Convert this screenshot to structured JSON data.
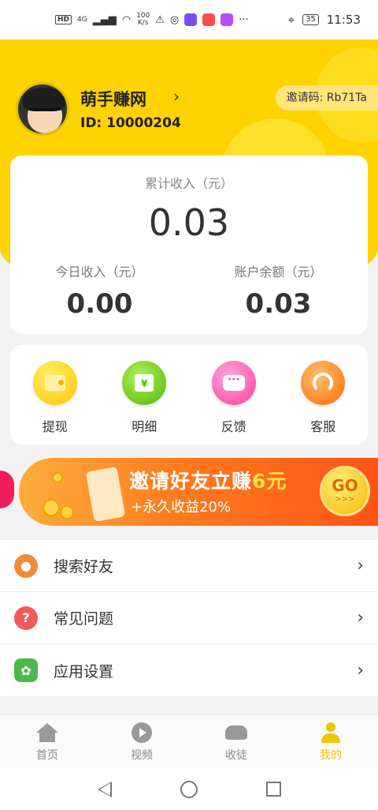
{
  "status_bar": {
    "hd": "HD",
    "network": "4G",
    "speed_value": "100",
    "speed_unit": "K/s",
    "battery": "35",
    "time": "11:53",
    "more": "···"
  },
  "profile": {
    "name": "萌手赚网",
    "id_label": "ID: 10000204",
    "invite_code_label": "邀请码: Rb71Ta",
    "arrow": "›"
  },
  "stats": {
    "total_label": "累计收入（元）",
    "total_value": "0.03",
    "today_label": "今日收入（元）",
    "today_value": "0.00",
    "balance_label": "账户余额（元）",
    "balance_value": "0.03"
  },
  "actions": [
    {
      "label": "提现",
      "color": "#ffd21a"
    },
    {
      "label": "明细",
      "color": "#6ad321"
    },
    {
      "label": "反馈",
      "color": "#ff5fb5"
    },
    {
      "label": "客服",
      "color": "#ff8f1c"
    }
  ],
  "banner": {
    "title_main": "邀请好友立赚",
    "title_amount": "6元",
    "subtitle": "+永久收益20%",
    "go": "GO",
    "go_arrows": ">>>"
  },
  "menu": [
    {
      "label": "搜索好友",
      "icon": "person-icon"
    },
    {
      "label": "常见问题",
      "icon": "question-icon",
      "glyph": "?"
    },
    {
      "label": "应用设置",
      "icon": "gear-icon"
    }
  ],
  "nav": [
    {
      "label": "首页",
      "icon": "home-icon"
    },
    {
      "label": "视频",
      "icon": "play-icon"
    },
    {
      "label": "收徒",
      "icon": "handshake-icon"
    },
    {
      "label": "我的",
      "icon": "user-icon",
      "active": true
    }
  ],
  "colors": {
    "brand_yellow": "#ffd200",
    "active_tab": "#f2c400",
    "banner_orange": "#ff7a1f"
  }
}
